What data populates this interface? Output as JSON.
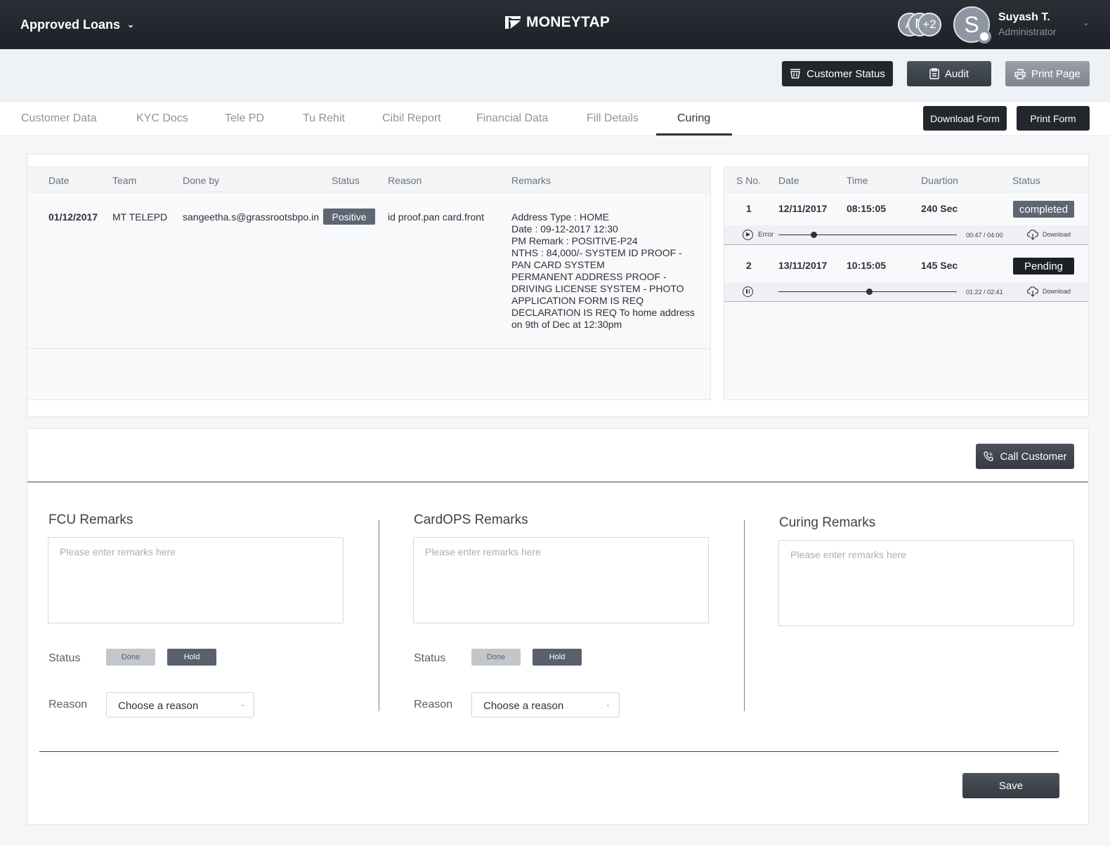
{
  "header": {
    "title": "Approved Loans",
    "logo_text": "MONEYTAP",
    "avatars": [
      "A",
      "N",
      "+2"
    ],
    "user": {
      "initial": "S",
      "name": "Suyash T.",
      "role": "Administrator"
    }
  },
  "actions": {
    "customer_status": "Customer Status",
    "audit": "Audit",
    "print_page": "Print Page",
    "download_form": "Download Form",
    "print_form": "Print  Form"
  },
  "tabs": [
    {
      "label": "Customer Data"
    },
    {
      "label": "KYC Docs"
    },
    {
      "label": "Tele PD"
    },
    {
      "label": "Tu Rehit"
    },
    {
      "label": "Cibil Report"
    },
    {
      "label": "Financial Data"
    },
    {
      "label": "Fill Details"
    },
    {
      "label": "Curing",
      "active": true
    }
  ],
  "history": {
    "headers": [
      "Date",
      "Team",
      "Done by",
      "Status",
      "Reason",
      "Remarks"
    ],
    "rows": [
      {
        "date": "01/12/2017",
        "team": "MT TELEPD",
        "done_by": "sangeetha.s@grassrootsbpo.in",
        "status": "Positive",
        "reason": "id proof.pan card.front",
        "remarks": [
          "Address Type : HOME",
          "Date : 09-12-2017 12:30",
          "PM Remark : POSITIVE-P24",
          "NTHS : 84,000/- SYSTEM ID PROOF -",
          "PAN CARD SYSTEM",
          "PERMANENT ADDRESS PROOF -",
          "DRIVING LICENSE SYSTEM - PHOTO",
          "APPLICATION FORM IS REQ",
          "DECLARATION IS REQ To home address",
          "on 9th of Dec at 12:30pm"
        ]
      }
    ]
  },
  "recordings": {
    "headers": [
      "S No.",
      "Date",
      "Time",
      "Duartion",
      "Status"
    ],
    "rows": [
      {
        "sno": "1",
        "date": "12/11/2017",
        "time": "08:15:05",
        "duration": "240 Sec",
        "status": "completed",
        "player_state": "play",
        "player_label": "Error",
        "elapsed": "00:47",
        "total": "04:00",
        "progress": 0.196,
        "download": "Download"
      },
      {
        "sno": "2",
        "date": "13/11/2017",
        "time": "10:15:05",
        "duration": "145 Sec",
        "status": "Pending",
        "player_state": "pause",
        "player_label": "",
        "elapsed": "01:22",
        "total": "02:41",
        "progress": 0.509,
        "download": "Download"
      }
    ]
  },
  "call_customer": "Call Customer",
  "sections": [
    {
      "title": "FCU Remarks",
      "placeholder": "Please enter remarks here",
      "status_label": "Status",
      "done": "Done",
      "hold": "Hold",
      "reason_label": "Reason",
      "reason_value": "Choose a reason"
    },
    {
      "title": "CardOPS Remarks",
      "placeholder": "Please enter remarks here",
      "status_label": "Status",
      "done": "Done",
      "hold": "Hold",
      "reason_label": "Reason",
      "reason_value": "Choose a reason"
    },
    {
      "title": "Curing Remarks",
      "placeholder": "Please enter remarks here"
    }
  ],
  "save_label": "Save",
  "colors": {
    "header_bg": "#1d2127",
    "badge_grey": "#5e6673",
    "badge_dark": "#1d2127",
    "accent_dark": "#23272d"
  }
}
